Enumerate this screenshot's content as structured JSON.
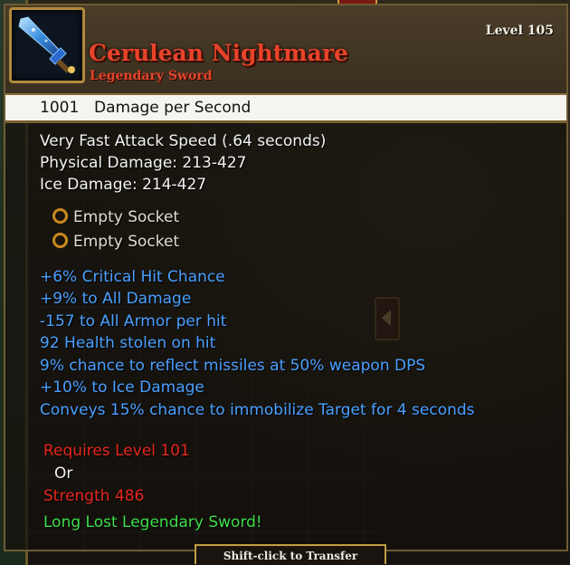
{
  "item": {
    "name": "Cerulean Nightmare",
    "type": "Legendary Sword",
    "level": "Level 105",
    "icon": "sword-icon",
    "name_color": "#e8432a"
  },
  "dps": {
    "value": "1001",
    "label": "Damage per Second"
  },
  "base_stats": [
    "Very Fast Attack Speed (.64 seconds)",
    "Physical Damage: 213-427",
    "Ice Damage: 214-427"
  ],
  "sockets": [
    "Empty Socket",
    "Empty Socket"
  ],
  "magic_stats": [
    "+6% Critical Hit Chance",
    "+9% to All Damage",
    "-157 to All Armor per hit",
    "92 Health stolen on hit",
    "9% chance to reflect missiles at 50% weapon DPS",
    "+10% to Ice Damage",
    "Conveys 15% chance to immobilize Target for 4 seconds"
  ],
  "requirements": {
    "level": "Requires Level 101",
    "or": "Or",
    "strength": "Strength 486"
  },
  "flavor": "Long Lost Legendary Sword!",
  "footer": {
    "transfer_hint": "Shift-click to Transfer"
  },
  "colors": {
    "magic": "#4aa0ff",
    "requirement": "#e8261e",
    "flavor": "#3dde4a",
    "legendary": "#e8432a"
  }
}
